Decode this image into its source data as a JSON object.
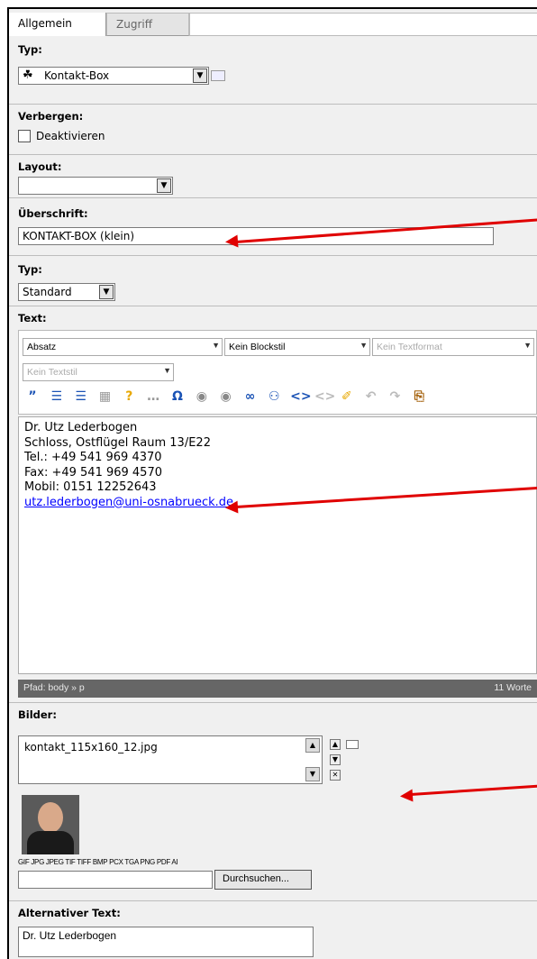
{
  "tabs": [
    {
      "label": "Allgemein"
    },
    {
      "label": "Zugriff"
    }
  ],
  "typ": {
    "label": "Typ:",
    "value": "Kontakt-Box"
  },
  "verbergen": {
    "label": "Verbergen:",
    "checkbox_label": "Deaktivieren"
  },
  "layout": {
    "label": "Layout:",
    "value": ""
  },
  "ueberschrift": {
    "label": "Überschrift:",
    "value": "KONTAKT-BOX (klein)"
  },
  "typ2": {
    "label": "Typ:",
    "value": "Standard"
  },
  "text": {
    "label": "Text:",
    "block_format": "Absatz",
    "block_style": "Kein Blockstil",
    "text_format": "Kein Textformat",
    "text_style": "Kein Textstil",
    "lines": [
      "Dr. Utz Lederbogen",
      "Schloss, Ostflügel Raum 13/E22",
      "Tel.: +49 541 969 4370",
      "Fax: +49 541 969 4570",
      "Mobil: 0151 12252643"
    ],
    "email": "utz.lederbogen@uni-osnabrueck.de",
    "status_path": "Pfad:  body » p",
    "word_count": "11 Worte"
  },
  "bilder": {
    "label": "Bilder:",
    "file": "kontakt_115x160_12.jpg",
    "filetypes": "GIF JPG JPEG TIF TIFF BMP PCX TGA PNG PDF AI",
    "browse_button": "Durchsuchen..."
  },
  "alt_text": {
    "label": "Alternativer Text:",
    "value": "Dr. Utz Lederbogen"
  },
  "colors": {
    "arrow": "#e00000",
    "link": "#0000ff",
    "statusbar": "#666666"
  }
}
